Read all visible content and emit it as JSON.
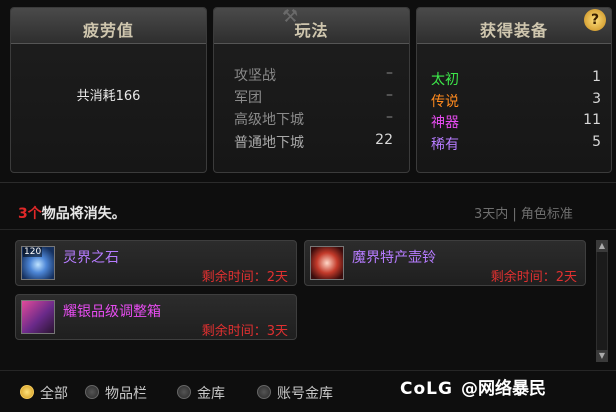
{
  "panels": {
    "fatigue": {
      "title": "疲劳值",
      "summary": "共消耗166"
    },
    "modes": {
      "title": "玩法",
      "rows": [
        {
          "name": "攻坚战",
          "value": "–"
        },
        {
          "name": "军团",
          "value": "–"
        },
        {
          "name": "高级地下城",
          "value": "–"
        },
        {
          "name": "普通地下城",
          "value": "22"
        }
      ]
    },
    "equipment": {
      "title": "获得装备",
      "rows": [
        {
          "name": "太初",
          "value": "1",
          "color": "#3de84a"
        },
        {
          "name": "传说",
          "value": "3",
          "color": "#ff8a1e"
        },
        {
          "name": "神器",
          "value": "11",
          "color": "#e64cf0"
        },
        {
          "name": "稀有",
          "value": "5",
          "color": "#b67cff"
        }
      ]
    }
  },
  "expiring": {
    "count": "3个",
    "message": "物品将消失。",
    "filter_label": "3天内 | 角色标准",
    "items": [
      {
        "name": "灵界之石",
        "name_color": "#b67cff",
        "level": "120",
        "time": "剩余时间：2天",
        "icon": "spirit-stone-icon"
      },
      {
        "name": "魔界特产壶铃",
        "name_color": "#b67cff",
        "level": "",
        "time": "剩余时间：2天",
        "icon": "demon-kettlebell-icon"
      },
      {
        "name": "耀银品级调整箱",
        "name_color": "#e64cf0",
        "level": "",
        "time": "剩余时间：3天",
        "icon": "grade-adjust-box-icon"
      }
    ]
  },
  "filters": [
    {
      "label": "全部",
      "selected": true
    },
    {
      "label": "物品栏",
      "selected": false
    },
    {
      "label": "金库",
      "selected": false
    },
    {
      "label": "账号金库",
      "selected": false
    }
  ],
  "help_label": "?",
  "watermark": {
    "brand": "CoLG",
    "handle": "@网络暴民"
  }
}
